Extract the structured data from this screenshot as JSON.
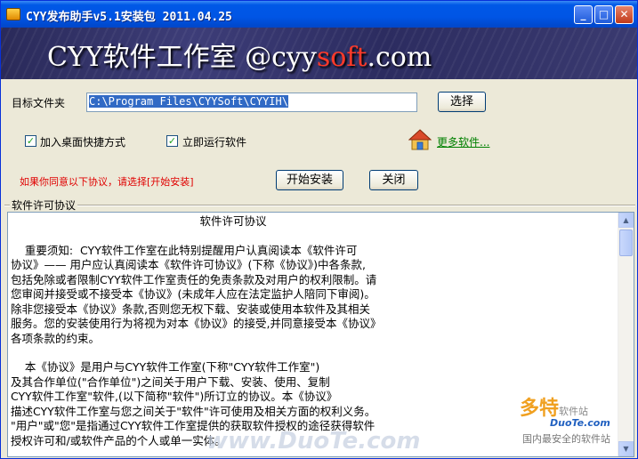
{
  "window": {
    "title": "CYY发布助手v5.1安装包 2011.04.25",
    "minimize_glyph": "_",
    "maximize_glyph": "□",
    "close_glyph": "✕"
  },
  "banner": {
    "text_pre": "CYY软件工作室 @cyy",
    "text_hl": "soft",
    "text_post": ".com"
  },
  "form": {
    "target_folder_label": "目标文件夹",
    "target_folder_value": "C:\\Program Files\\CYYSoft\\CYYIH\\",
    "browse_button": "选择",
    "desktop_shortcut_label": "加入桌面快捷方式",
    "desktop_shortcut_checked": true,
    "run_now_label": "立即运行软件",
    "run_now_checked": true,
    "more_software_link": "更多软件...",
    "notice": "如果你同意以下协议，请选择[开始安装]",
    "install_button": "开始安装",
    "close_button": "关闭",
    "check_glyph": "✓"
  },
  "license": {
    "group_label": "软件许可协议",
    "title": "软件许可协议",
    "lines": [
      "    重要须知:  CYY软件工作室在此特别提醒用户认真阅读本《软件许可",
      "协议》—— 用户应认真阅读本《软件许可协议》(下称《协议》)中各条款,",
      "包括免除或者限制CYY软件工作室责任的免责条款及对用户的权利限制。请",
      "您审阅并接受或不接受本《协议》(未成年人应在法定监护人陪同下审阅)。",
      "除非您接受本《协议》条款,否则您无权下载、安装或使用本软件及其相关",
      "服务。您的安装使用行为将视为对本《协议》的接受,并同意接受本《协议》",
      "各项条款的约束。",
      "",
      "    本《协议》是用户与CYY软件工作室(下称\"CYY软件工作室\")",
      "及其合作单位(\"合作单位\")之间关于用户下载、安装、使用、复制",
      "CYY软件工作室\"软件,(以下简称\"软件\")所订立的协议。本《协议》",
      "描述CYY软件工作室与您之间关于\"软件\"许可使用及相关方面的权利义务。",
      "\"用户\"或\"您\"是指通过CYY软件工作室提供的获取软件授权的途径获得软件",
      "授权许可和/或软件产品的个人或单一实体。"
    ],
    "scroll_up_glyph": "▲",
    "scroll_down_glyph": "▼"
  },
  "watermarks": {
    "duote_main": "www.DuoTe.com",
    "brand_big": "多特",
    "brand_small": "软件站",
    "brand_url": "DuoTe.com",
    "brand_slogan": "国内最安全的软件站"
  }
}
